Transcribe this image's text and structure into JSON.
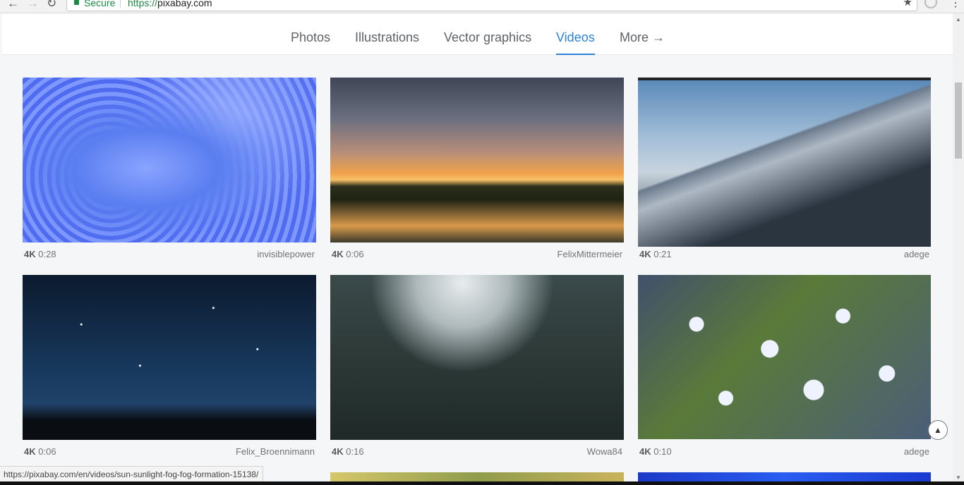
{
  "browser": {
    "secure_label": "Secure",
    "url_scheme": "https://",
    "url_host": "pixabay.com",
    "star_icon": "★"
  },
  "tabs": [
    {
      "label": "Photos"
    },
    {
      "label": "Illustrations"
    },
    {
      "label": "Vector graphics"
    },
    {
      "label": "Videos",
      "active": true
    },
    {
      "label": "More →"
    }
  ],
  "videos": [
    {
      "quality": "4K",
      "duration": "0:28",
      "author": "invisiblepower"
    },
    {
      "quality": "4K",
      "duration": "0:06",
      "author": "FelixMittermeier"
    },
    {
      "quality": "4K",
      "duration": "0:21",
      "author": "adege"
    },
    {
      "quality": "4K",
      "duration": "0:06",
      "author": "Felix_Broennimann"
    },
    {
      "quality": "4K",
      "duration": "0:16",
      "author": "Wowa84"
    },
    {
      "quality": "4K",
      "duration": "0:10",
      "author": "adege"
    }
  ],
  "status_url": "https://pixabay.com/en/videos/sun-sunlight-fog-fog-formation-15138/",
  "scroll_top_icon": "▲",
  "colors": {
    "accent": "#2b82d6",
    "secure": "#1d8a42"
  }
}
